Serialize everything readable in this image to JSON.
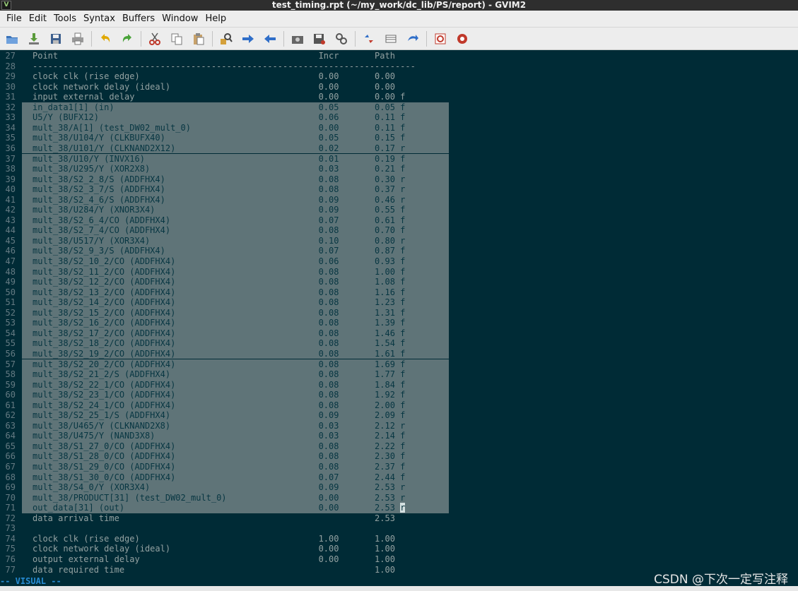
{
  "window": {
    "title": "test_timing.rpt (~/my_work/dc_lib/PS/report) - GVIM2",
    "icon_text": "V"
  },
  "menu": [
    "File",
    "Edit",
    "Tools",
    "Syntax",
    "Buffers",
    "Window",
    "Help"
  ],
  "toolbar": {
    "icons": [
      "open-icon",
      "save-download-icon",
      "save-icon",
      "print-icon",
      "undo-icon",
      "redo-icon",
      "cut-icon",
      "copy-icon",
      "paste-icon",
      "find-replace-icon",
      "forward-arrow-icon",
      "back-arrow-icon",
      "load-session-icon",
      "save-session-icon",
      "run-script-icon",
      "make-icon",
      "shell-icon",
      "tag-jump-icon",
      "help-icon",
      "find-help-icon"
    ]
  },
  "editor": {
    "lines": [
      {
        "n": "27",
        "text": "Point                                                   Incr       Path",
        "sel": "none"
      },
      {
        "n": "28",
        "text": "---------------------------------------------------------------------------",
        "sel": "none"
      },
      {
        "n": "29",
        "text": "clock clk (rise edge)                                   0.00       0.00",
        "sel": "none"
      },
      {
        "n": "30",
        "text": "clock network delay (ideal)                             0.00       0.00",
        "sel": "none"
      },
      {
        "n": "31",
        "text": "input external delay                                    0.00       0.00 f",
        "sel": "none"
      },
      {
        "n": "32",
        "text": "in_data1[1] (in)                                        0.05       0.05 f",
        "sel": "full"
      },
      {
        "n": "33",
        "text": "U5/Y (BUFX12)                                           0.06       0.11 f",
        "sel": "full"
      },
      {
        "n": "34",
        "text": "mult_38/A[1] (test_DW02_mult_0)                         0.00       0.11 f",
        "sel": "full"
      },
      {
        "n": "35",
        "text": "mult_38/U104/Y (CLKBUFX40)                              0.05       0.15 f",
        "sel": "full"
      },
      {
        "n": "36",
        "text": "mult_38/U101/Y (CLKNAND2X12)                            0.02       0.17 r",
        "sel": "full"
      },
      {
        "n": "37",
        "text": "mult_38/U10/Y (INVX16)                                  0.01       0.19 f",
        "sel": "full"
      },
      {
        "n": "38",
        "text": "mult_38/U295/Y (XOR2X8)                                 0.03       0.21 f",
        "sel": "full"
      },
      {
        "n": "39",
        "text": "mult_38/S2_2_8/S (ADDFHX4)                              0.08       0.30 r",
        "sel": "full"
      },
      {
        "n": "40",
        "text": "mult_38/S2_3_7/S (ADDFHX4)                              0.08       0.37 r",
        "sel": "full"
      },
      {
        "n": "41",
        "text": "mult_38/S2_4_6/S (ADDFHX4)                              0.09       0.46 r",
        "sel": "full"
      },
      {
        "n": "42",
        "text": "mult_38/U284/Y (XNOR3X4)                                0.09       0.55 f",
        "sel": "full"
      },
      {
        "n": "43",
        "text": "mult_38/S2_6_4/CO (ADDFHX4)                             0.07       0.61 f",
        "sel": "full"
      },
      {
        "n": "44",
        "text": "mult_38/S2_7_4/CO (ADDFHX4)                             0.08       0.70 f",
        "sel": "full"
      },
      {
        "n": "45",
        "text": "mult_38/U517/Y (XOR3X4)                                 0.10       0.80 r",
        "sel": "full"
      },
      {
        "n": "46",
        "text": "mult_38/S2_9_3/S (ADDFHX4)                              0.07       0.87 f",
        "sel": "full"
      },
      {
        "n": "47",
        "text": "mult_38/S2_10_2/CO (ADDFHX4)                            0.06       0.93 f",
        "sel": "full"
      },
      {
        "n": "48",
        "text": "mult_38/S2_11_2/CO (ADDFHX4)                            0.08       1.00 f",
        "sel": "full"
      },
      {
        "n": "49",
        "text": "mult_38/S2_12_2/CO (ADDFHX4)                            0.08       1.08 f",
        "sel": "full"
      },
      {
        "n": "50",
        "text": "mult_38/S2_13_2/CO (ADDFHX4)                            0.08       1.16 f",
        "sel": "full"
      },
      {
        "n": "51",
        "text": "mult_38/S2_14_2/CO (ADDFHX4)                            0.08       1.23 f",
        "sel": "full"
      },
      {
        "n": "52",
        "text": "mult_38/S2_15_2/CO (ADDFHX4)                            0.08       1.31 f",
        "sel": "full"
      },
      {
        "n": "53",
        "text": "mult_38/S2_16_2/CO (ADDFHX4)                            0.08       1.39 f",
        "sel": "full"
      },
      {
        "n": "54",
        "text": "mult_38/S2_17_2/CO (ADDFHX4)                            0.08       1.46 f",
        "sel": "full"
      },
      {
        "n": "55",
        "text": "mult_38/S2_18_2/CO (ADDFHX4)                            0.08       1.54 f",
        "sel": "full"
      },
      {
        "n": "56",
        "text": "mult_38/S2_19_2/CO (ADDFHX4)                            0.08       1.61 f",
        "sel": "full"
      },
      {
        "n": "57",
        "text": "mult_38/S2_20_2/CO (ADDFHX4)                            0.08       1.69 f",
        "sel": "full"
      },
      {
        "n": "58",
        "text": "mult_38/S2_21_2/S (ADDFHX4)                             0.08       1.77 f",
        "sel": "full"
      },
      {
        "n": "59",
        "text": "mult_38/S2_22_1/CO (ADDFHX4)                            0.08       1.84 f",
        "sel": "full"
      },
      {
        "n": "60",
        "text": "mult_38/S2_23_1/CO (ADDFHX4)                            0.08       1.92 f",
        "sel": "full"
      },
      {
        "n": "61",
        "text": "mult_38/S2_24_1/CO (ADDFHX4)                            0.08       2.00 f",
        "sel": "full"
      },
      {
        "n": "62",
        "text": "mult_38/S2_25_1/S (ADDFHX4)                             0.09       2.09 f",
        "sel": "full"
      },
      {
        "n": "63",
        "text": "mult_38/U465/Y (CLKNAND2X8)                             0.03       2.12 r",
        "sel": "full"
      },
      {
        "n": "64",
        "text": "mult_38/U475/Y (NAND3X8)                                0.03       2.14 f",
        "sel": "full"
      },
      {
        "n": "65",
        "text": "mult_38/S1_27_0/CO (ADDFHX4)                            0.08       2.22 f",
        "sel": "full"
      },
      {
        "n": "66",
        "text": "mult_38/S1_28_0/CO (ADDFHX4)                            0.08       2.30 f",
        "sel": "full"
      },
      {
        "n": "67",
        "text": "mult_38/S1_29_0/CO (ADDFHX4)                            0.08       2.37 f",
        "sel": "full"
      },
      {
        "n": "68",
        "text": "mult_38/S1_30_0/CO (ADDFHX4)                            0.07       2.44 f",
        "sel": "full"
      },
      {
        "n": "69",
        "text": "mult_38/S4_0/Y (XOR3X4)                                 0.09       2.53 r",
        "sel": "full"
      },
      {
        "n": "70",
        "text": "mult_38/PRODUCT[31] (test_DW02_mult_0)                  0.00       2.53 r",
        "sel": "full"
      },
      {
        "n": "71",
        "text": "out_data[31] (out)                                      0.00       2.53 r",
        "sel": "cursor"
      },
      {
        "n": "72",
        "text": "data arrival time                                                  2.53",
        "sel": "none"
      },
      {
        "n": "73",
        "text": "",
        "sel": "none"
      },
      {
        "n": "74",
        "text": "clock clk (rise edge)                                   1.00       1.00",
        "sel": "none"
      },
      {
        "n": "75",
        "text": "clock network delay (ideal)                             0.00       1.00",
        "sel": "none"
      },
      {
        "n": "76",
        "text": "output external delay                                   0.00       1.00",
        "sel": "none"
      },
      {
        "n": "77",
        "text": "data required time                                                 1.00",
        "sel": "none"
      }
    ]
  },
  "status": {
    "mode": "-- VISUAL --"
  },
  "watermark": "CSDN @下次一定写注释"
}
